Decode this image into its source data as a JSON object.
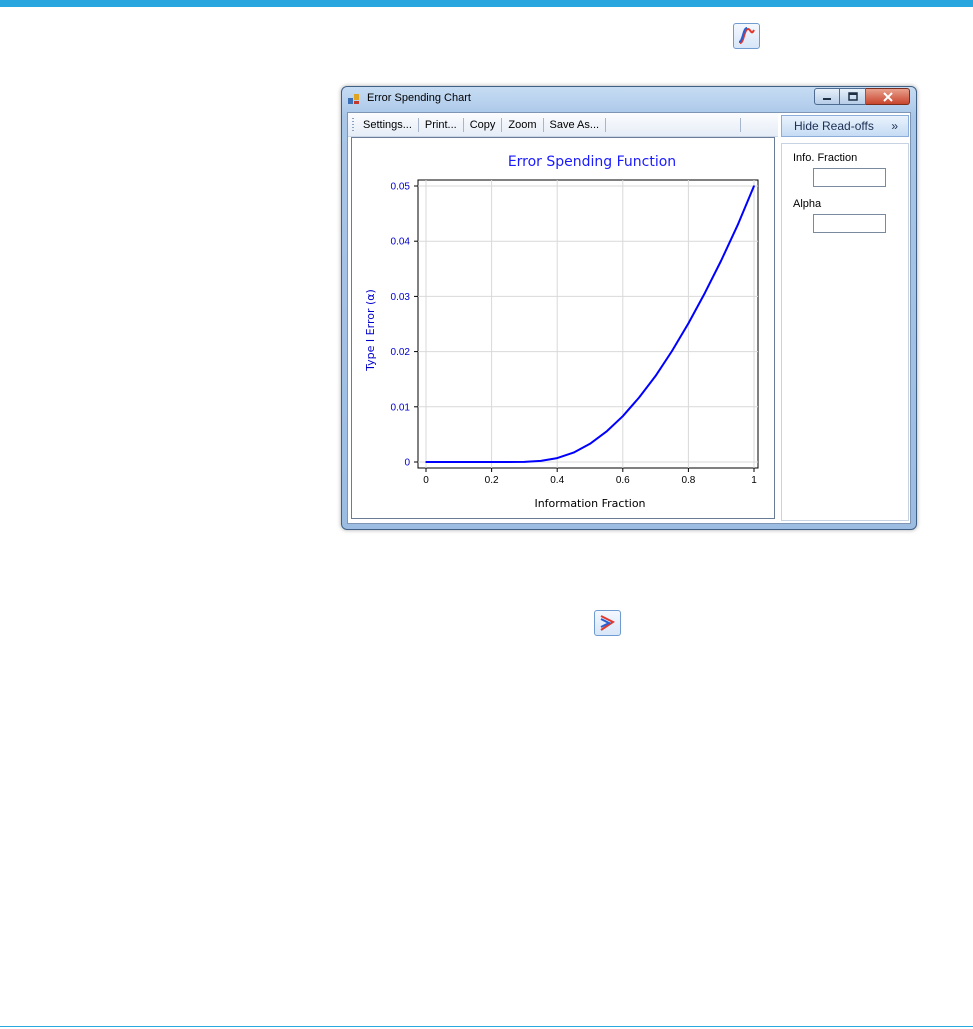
{
  "window": {
    "title": "Error Spending Chart",
    "min_icon": "minimize-icon",
    "max_icon": "maximize-icon",
    "close_icon": "close-icon"
  },
  "toolbar": {
    "items": [
      "Settings...",
      "Print...",
      "Copy",
      "Zoom",
      "Save As..."
    ]
  },
  "side_panel": {
    "hide_button": "Hide Read-offs",
    "hide_button_glyph": "»",
    "info_fraction_label": "Info. Fraction",
    "info_fraction_value": "",
    "alpha_label": "Alpha",
    "alpha_value": ""
  },
  "icons": {
    "top": "spending-function-app-icon",
    "bottom": "boundary-app-icon"
  },
  "colors": {
    "accent": "#2aa6df",
    "curve": "#0000ff",
    "title": "#1a1aff",
    "tick_labels": "#0000cc"
  },
  "chart_data": {
    "type": "line",
    "title": "Error Spending Function",
    "xlabel": "Information Fraction",
    "ylabel": "Type I Error (α)",
    "xlim": [
      0,
      1
    ],
    "ylim": [
      0,
      0.05
    ],
    "x_ticks": [
      "0",
      "0.2",
      "0.4",
      "0.6",
      "0.8",
      "1"
    ],
    "y_ticks": [
      "0",
      "0.01",
      "0.02",
      "0.03",
      "0.04",
      "0.05"
    ],
    "grid": true,
    "series": [
      {
        "x": [
          0,
          0.05,
          0.1,
          0.15,
          0.2,
          0.25,
          0.3,
          0.35,
          0.4,
          0.45,
          0.5,
          0.55,
          0.6,
          0.65,
          0.7,
          0.75,
          0.8,
          0.85,
          0.9,
          0.95,
          1.0
        ],
        "y": [
          0,
          0,
          0,
          0,
          0,
          0,
          2e-05,
          0.0002,
          0.0007,
          0.0017,
          0.0033,
          0.0055,
          0.0083,
          0.0117,
          0.0156,
          0.0201,
          0.0251,
          0.0306,
          0.0365,
          0.0429,
          0.05
        ]
      }
    ]
  }
}
